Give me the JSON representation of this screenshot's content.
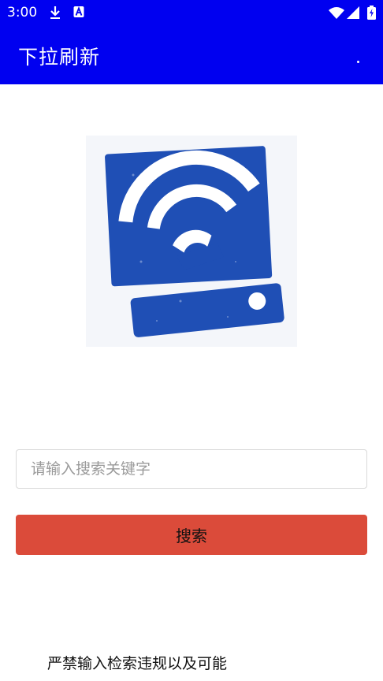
{
  "status_bar": {
    "time": "3:00",
    "left_icons": [
      "download-icon",
      "translate-a-icon"
    ],
    "right_icons": [
      "wifi-icon",
      "signal-icon",
      "battery-charging-icon"
    ]
  },
  "app_bar": {
    "title": "下拉刷新",
    "color": "#0000f0"
  },
  "logo": {
    "icon": "wifi-hard-drive-logo",
    "color": "#1f4fb5"
  },
  "search": {
    "placeholder": "请输入搜索关键字",
    "value": "",
    "button_label": "搜索",
    "button_color": "#db4b3a"
  },
  "footer": {
    "notice": "严禁输入检索违规以及可能"
  }
}
